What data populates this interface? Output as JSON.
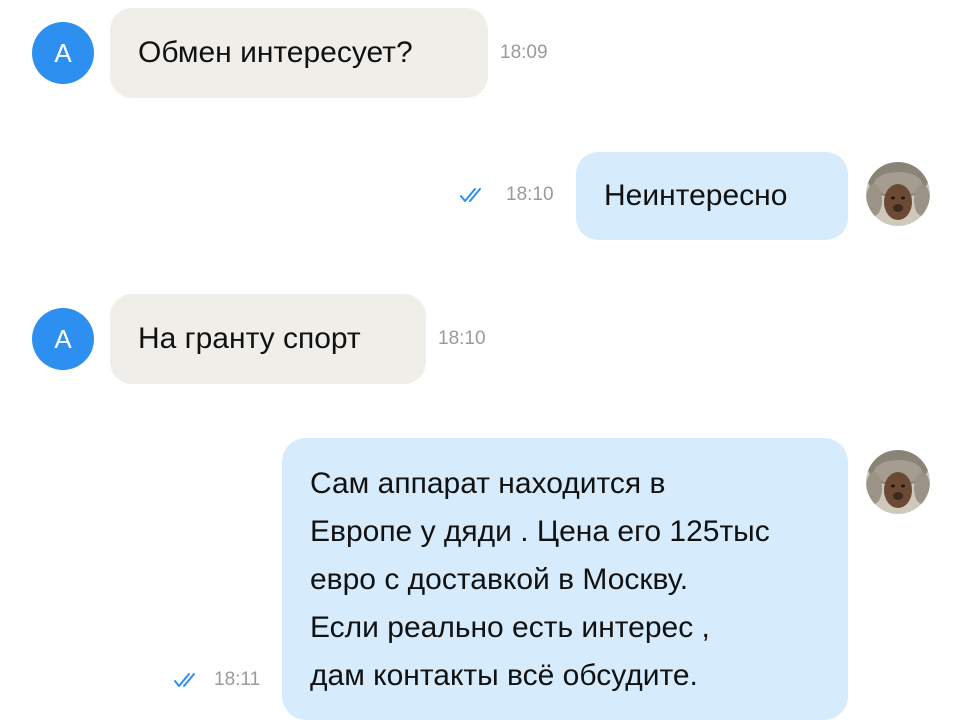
{
  "messages": [
    {
      "direction": "incoming",
      "avatar_letter": "А",
      "text": "Обмен интересует?",
      "time": "18:09"
    },
    {
      "direction": "outgoing",
      "status_icon": "double-check-icon",
      "text": "Неинтересно",
      "time": "18:10"
    },
    {
      "direction": "incoming",
      "avatar_letter": "А",
      "text": "На гранту спорт",
      "time": "18:10"
    },
    {
      "direction": "outgoing",
      "status_icon": "double-check-icon",
      "lines": [
        "Сам аппарат находится в",
        "Европе у дяди . Цена его 125тыс",
        "евро с доставкой в Москву.",
        "Если реально есть  интерес ,",
        "дам контакты всё обсудите."
      ],
      "time": "18:11"
    }
  ],
  "colors": {
    "incoming_bubble": "#efeee9",
    "outgoing_bubble": "#d6ecfd",
    "avatar_blue": "#2d8ff0",
    "read_ticks": "#2d8ff0",
    "timestamp": "#9a9a9a"
  }
}
